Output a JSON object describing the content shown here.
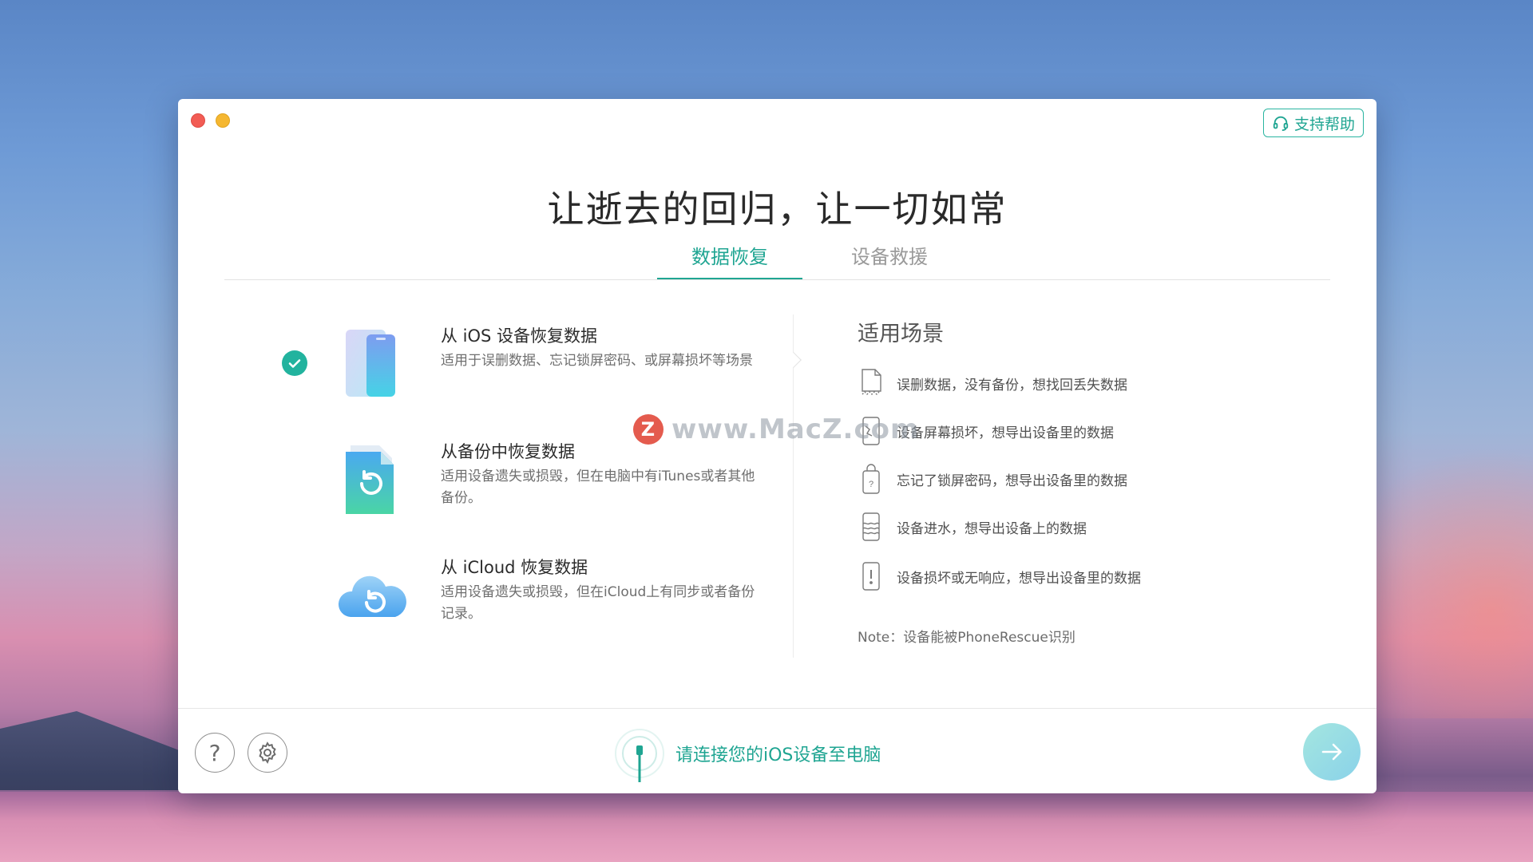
{
  "window": {
    "title": "让逝去的回归，让一切如常",
    "support_label": "支持帮助"
  },
  "tabs": [
    {
      "label": "数据恢复",
      "active": true
    },
    {
      "label": "设备救援",
      "active": false
    }
  ],
  "options": [
    {
      "title": "从 iOS 设备恢复数据",
      "desc": "适用于误删数据、忘记锁屏密码、或屏幕损坏等场景",
      "selected": true,
      "icon": "iphone-icon"
    },
    {
      "title": "从备份中恢复数据",
      "desc": "适用设备遗失或损毁，但在电脑中有iTunes或者其他备份。",
      "selected": false,
      "icon": "backup-file-icon"
    },
    {
      "title": "从 iCloud 恢复数据",
      "desc": "适用设备遗失或损毁，但在iCloud上有同步或者备份记录。",
      "selected": false,
      "icon": "icloud-icon"
    }
  ],
  "scenarios": {
    "title": "适用场景",
    "items": [
      {
        "text": "误删数据，没有备份，想找回丢失数据",
        "icon": "deleted-file-icon"
      },
      {
        "text": "设备屏幕损坏，想导出设备里的数据",
        "icon": "broken-screen-icon"
      },
      {
        "text": "忘记了锁屏密码，想导出设备里的数据",
        "icon": "locked-phone-icon"
      },
      {
        "text": "设备进水，想导出设备上的数据",
        "icon": "water-damage-icon"
      },
      {
        "text": "设备损坏或无响应，想导出设备里的数据",
        "icon": "unresponsive-phone-icon"
      }
    ],
    "note": "Note：设备能被PhoneRescue识别"
  },
  "footer": {
    "help_label": "?",
    "connect_text": "请连接您的iOS设备至电脑"
  },
  "watermark": {
    "badge": "Z",
    "text": "www.MacZ.com"
  },
  "colors": {
    "accent": "#1fa592",
    "check": "#22b39e",
    "close": "#f25c54",
    "minimize": "#f5b731"
  }
}
